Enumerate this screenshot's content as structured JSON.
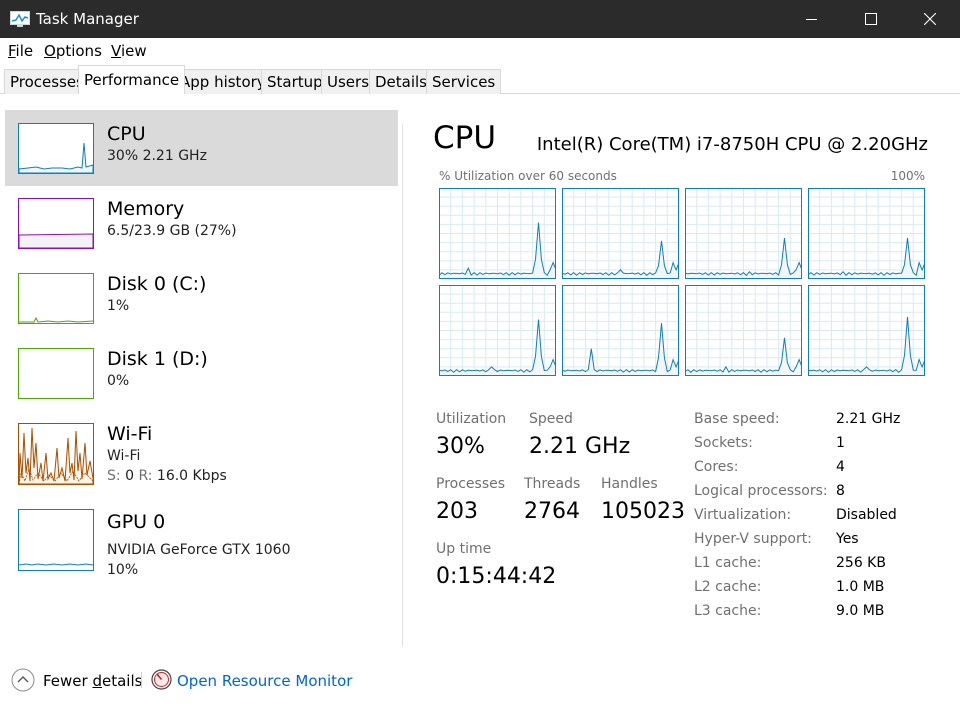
{
  "window": {
    "title": "Task Manager"
  },
  "menu": {
    "file": "File",
    "options": "Options",
    "view": "View"
  },
  "tabs": [
    "Processes",
    "Performance",
    "App history",
    "Startup",
    "Users",
    "Details",
    "Services"
  ],
  "active_tab": "Performance",
  "sidebar": {
    "items": [
      {
        "name": "CPU",
        "sub1": "30%  2.21 GHz",
        "color": "#117dbb",
        "selected": true
      },
      {
        "name": "Memory",
        "sub1": "6.5/23.9 GB (27%)",
        "color": "#8b12ae"
      },
      {
        "name": "Disk 0 (C:)",
        "sub1": "1%",
        "color": "#4da60c"
      },
      {
        "name": "Disk 1 (D:)",
        "sub1": "0%",
        "color": "#4da60c"
      },
      {
        "name": "Wi-Fi",
        "sub1": "Wi-Fi",
        "s_label": "S:",
        "s_value": "0",
        "r_label": "R:",
        "r_value": "16.0 Kbps",
        "color": "#a74f01"
      },
      {
        "name": "GPU 0",
        "sub1": "NVIDIA GeForce GTX 1060",
        "sub2": "10%",
        "color": "#117dbb"
      }
    ]
  },
  "main": {
    "title": "CPU",
    "model": "Intel(R) Core(TM) i7-8750H CPU @ 2.20GHz",
    "graph_label": "% Utilization over 60 seconds",
    "graph_max": "100%",
    "stats": {
      "utilization_label": "Utilization",
      "utilization": "30%",
      "speed_label": "Speed",
      "speed": "2.21 GHz",
      "processes_label": "Processes",
      "processes": "203",
      "threads_label": "Threads",
      "threads": "2764",
      "handles_label": "Handles",
      "handles": "105023",
      "uptime_label": "Up time",
      "uptime": "0:15:44:42"
    },
    "specs": [
      {
        "label": "Base speed:",
        "value": "2.21 GHz"
      },
      {
        "label": "Sockets:",
        "value": "1"
      },
      {
        "label": "Cores:",
        "value": "4"
      },
      {
        "label": "Logical processors:",
        "value": "8"
      },
      {
        "label": "Virtualization:",
        "value": "Disabled"
      },
      {
        "label": "Hyper-V support:",
        "value": "Yes"
      },
      {
        "label": "L1 cache:",
        "value": "256 KB"
      },
      {
        "label": "L2 cache:",
        "value": "1.0 MB"
      },
      {
        "label": "L3 cache:",
        "value": "9.0 MB"
      }
    ]
  },
  "bottom": {
    "fewer_details": "Fewer details",
    "open_resource_monitor": "Open Resource Monitor"
  },
  "colors": {
    "cpu_graph": "#117dbb",
    "cpu_fill": "#f1f6fa",
    "grid": "#d9eaf4",
    "link": "#0066cc",
    "titlebar": "#2b2b2b"
  }
}
